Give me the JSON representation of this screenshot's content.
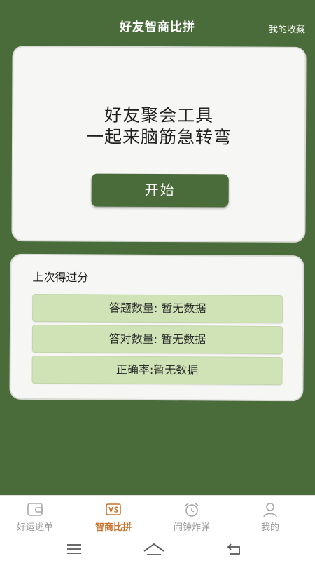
{
  "header": {
    "title": "好友智商比拼",
    "favorites_label": "我的收藏"
  },
  "hero": {
    "line1": "好友聚会工具",
    "line2": "一起来脑筋急转弯",
    "start_label": "开始"
  },
  "last_score": {
    "title": "上次得过分",
    "rows": [
      "答题数量: 暂无数据",
      "答对数量: 暂无数据",
      "正确率:暂无数据"
    ]
  },
  "tabs": [
    {
      "label": "好运逃单",
      "icon": "wallet-icon",
      "active": false
    },
    {
      "label": "智商比拼",
      "icon": "vs-icon",
      "active": true
    },
    {
      "label": "闹钟炸弹",
      "icon": "alarm-clock-icon",
      "active": false
    },
    {
      "label": "我的",
      "icon": "user-icon",
      "active": false
    }
  ],
  "system_nav": [
    "menu-icon",
    "home-icon",
    "back-icon"
  ],
  "colors": {
    "background": "#4a6b3a",
    "card": "#f6f6f4",
    "stat_row": "#cfe3b6",
    "active_tab": "#c8732b",
    "inactive_tab": "#9a9a9a"
  }
}
